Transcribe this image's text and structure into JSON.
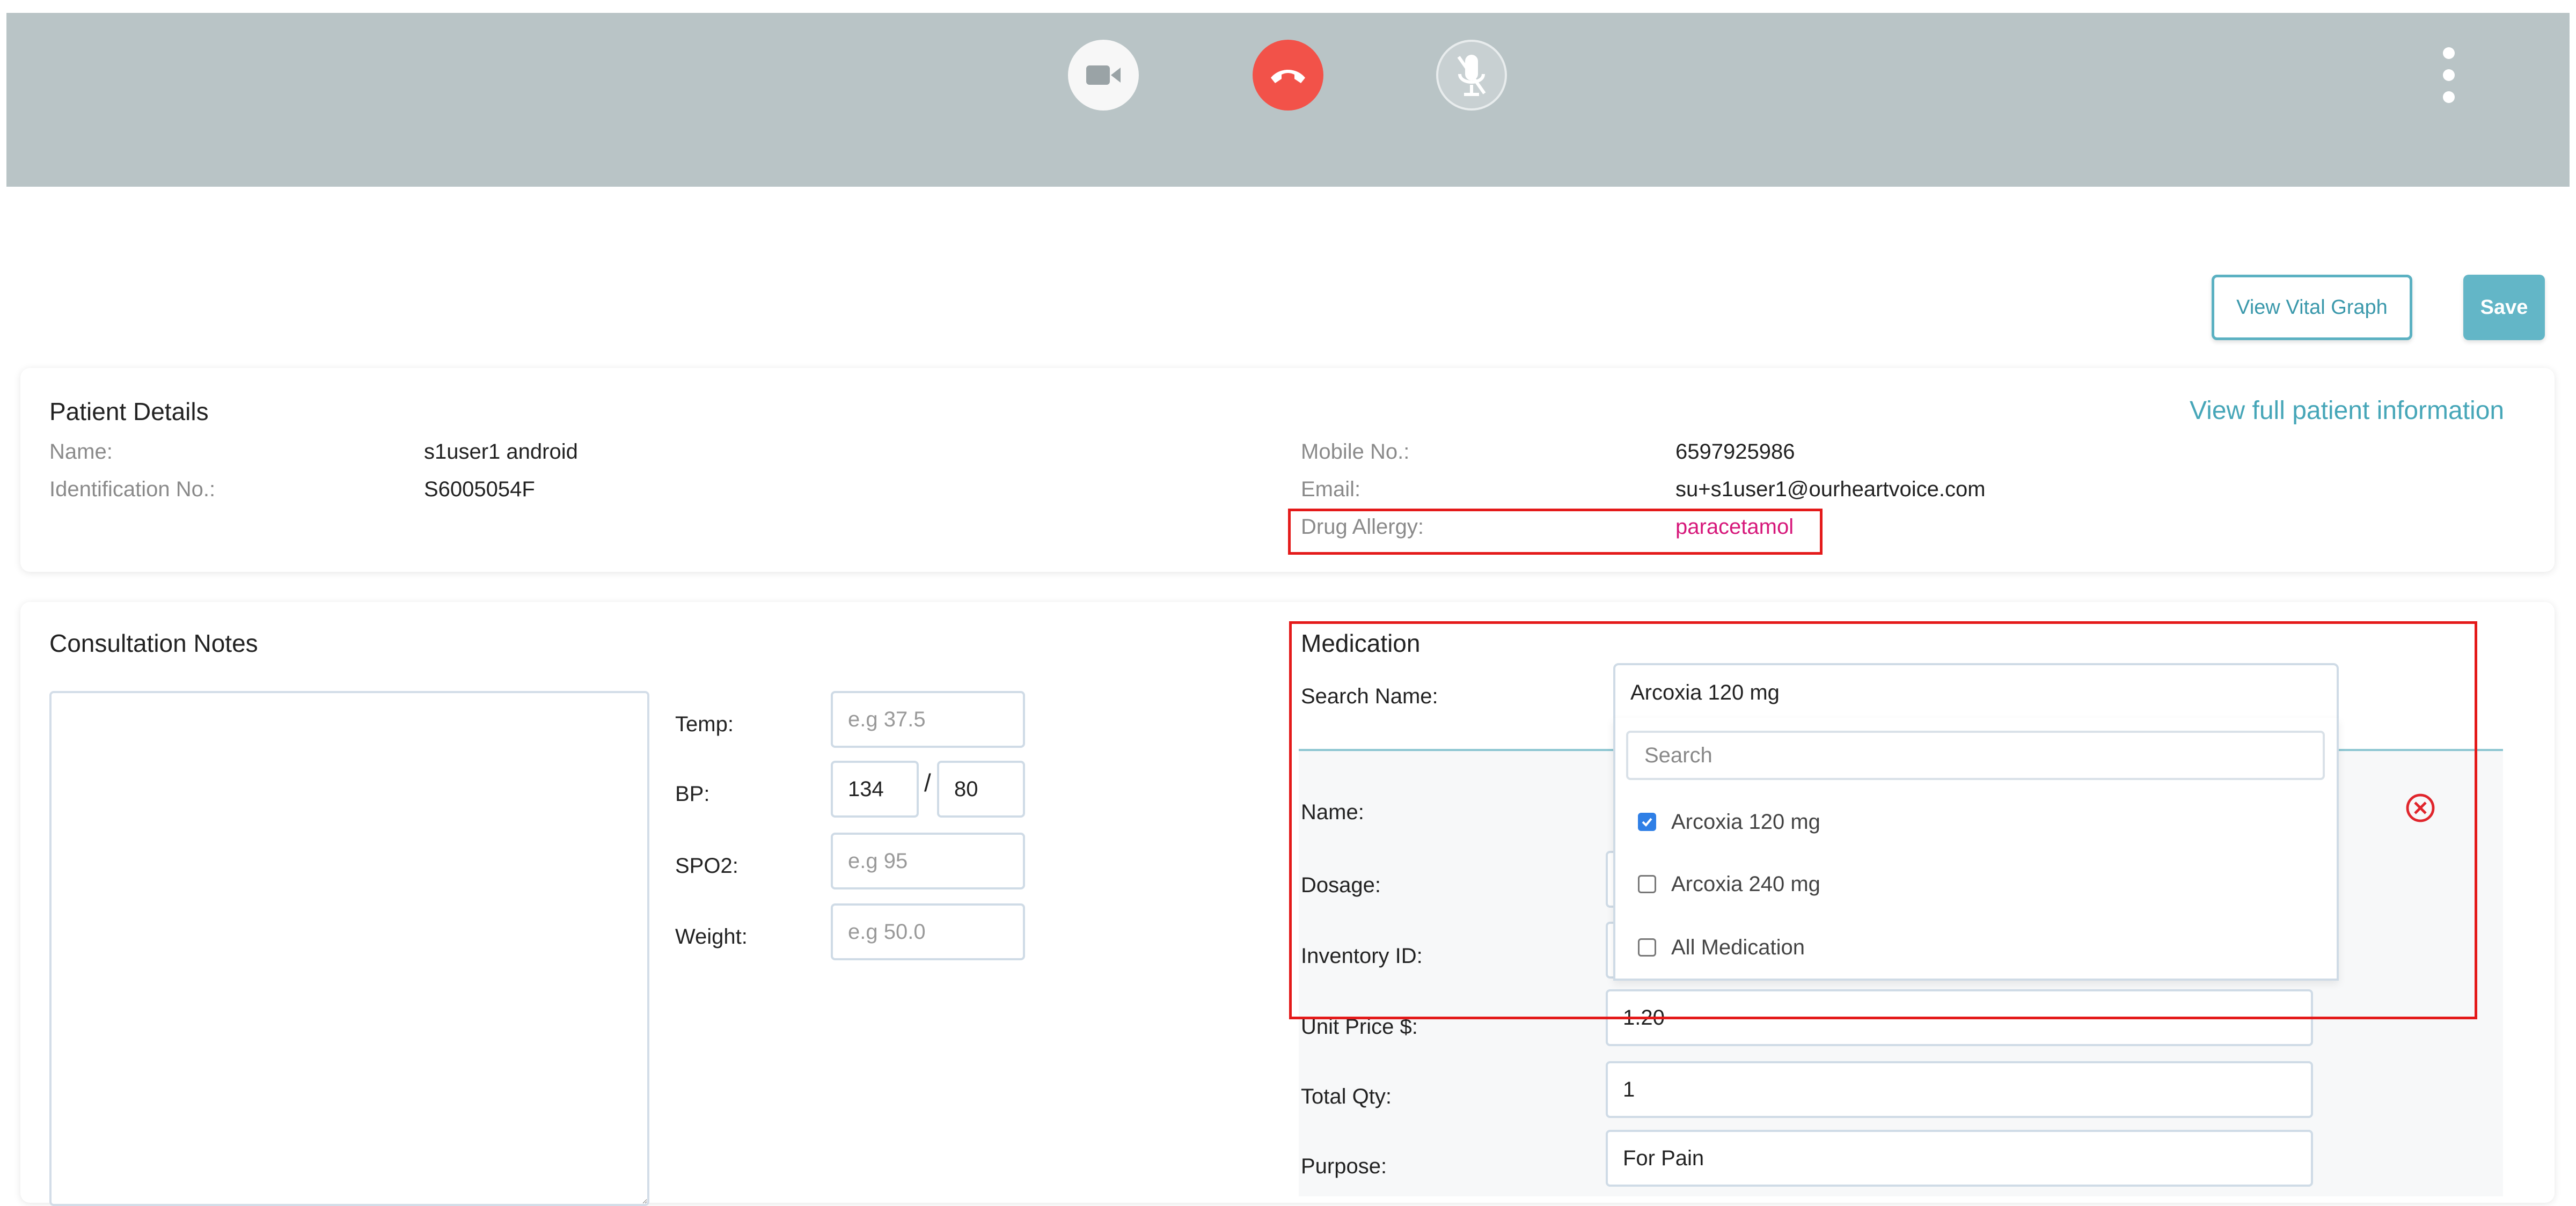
{
  "call": {
    "icons": {
      "video": "video-camera-icon",
      "hangup": "phone-hangup-icon",
      "mic": "mic-off-icon",
      "menu": "more-vertical-icon"
    },
    "colors": {
      "bar": "#b9c4c6",
      "hangup": "#f25249"
    }
  },
  "actions": {
    "view_vital_graph": "View Vital Graph",
    "save": "Save"
  },
  "patient": {
    "title": "Patient Details",
    "view_full": "View full patient information",
    "name_label": "Name:",
    "name": "s1user1 android",
    "id_label": "Identification No.:",
    "id": "S6005054F",
    "mobile_label": "Mobile No.:",
    "mobile": "6597925986",
    "email_label": "Email:",
    "email": "su+s1user1@ourheartvoice.com",
    "allergy_label": "Drug Allergy:",
    "allergy": "paracetamol"
  },
  "consult": {
    "title": "Consultation Notes",
    "temp_label": "Temp:",
    "temp_placeholder": "e.g 37.5",
    "bp_label": "BP:",
    "bp_sys": "134",
    "bp_sep": "/",
    "bp_dia": "80",
    "spo2_label": "SPO2:",
    "spo2_placeholder": "e.g 95",
    "weight_label": "Weight:",
    "weight_placeholder": "e.g 50.0"
  },
  "medication": {
    "title": "Medication",
    "search_label": "Search Name:",
    "selected": "Arcoxia 120 mg",
    "search_placeholder": "Search",
    "options": [
      {
        "label": "Arcoxia 120 mg",
        "checked": true
      },
      {
        "label": "Arcoxia 240 mg",
        "checked": false
      },
      {
        "label": "All Medication",
        "checked": false
      }
    ],
    "name_label": "Name:",
    "dosage_label": "Dosage:",
    "inventory_label": "Inventory ID:",
    "unit_price_label": "Unit Price $:",
    "unit_price": "1.20",
    "total_qty_label": "Total Qty:",
    "total_qty": "1",
    "purpose_label": "Purpose:",
    "purpose": "For Pain"
  }
}
